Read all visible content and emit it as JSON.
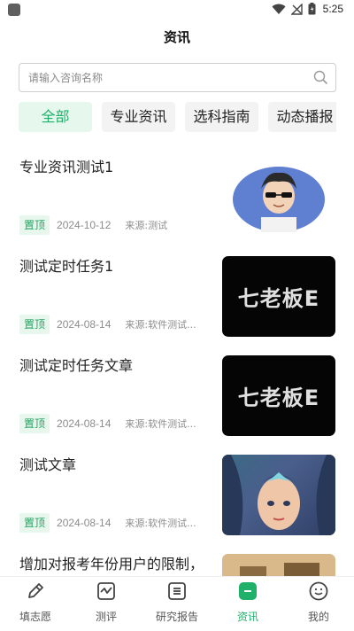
{
  "status_bar": {
    "time": "5:25"
  },
  "header": {
    "title": "资讯"
  },
  "search": {
    "placeholder": "请输入咨询名称"
  },
  "tabs": [
    {
      "label": "全部",
      "active": true
    },
    {
      "label": "专业资讯",
      "active": false
    },
    {
      "label": "选科指南",
      "active": false
    },
    {
      "label": "动态播报",
      "active": false
    }
  ],
  "articles": [
    {
      "title": "专业资讯测试1",
      "pin": "置顶",
      "date": "2024-10-12",
      "source": "来源:测试",
      "thumb": "avatar-cartoon-image"
    },
    {
      "title": "测试定时任务1",
      "pin": "置顶",
      "date": "2024-08-14",
      "source": "来源:软件测试...",
      "thumb": "七老板E"
    },
    {
      "title": "测试定时任务文章",
      "pin": "置顶",
      "date": "2024-08-14",
      "source": "来源:软件测试...",
      "thumb": "七老板E"
    },
    {
      "title": "测试文章",
      "pin": "置顶",
      "date": "2024-08-14",
      "source": "来源:软件测试...",
      "thumb": "game-hero-image"
    },
    {
      "title": "增加对报考年份用户的限制，根据省份、报考开启后非报",
      "pin": "",
      "date": "",
      "source": "",
      "thumb": "scene-image"
    }
  ],
  "tabbar": [
    {
      "label": "填志愿",
      "icon": "pencil-icon",
      "active": false
    },
    {
      "label": "测评",
      "icon": "chart-icon",
      "active": false
    },
    {
      "label": "研究报告",
      "icon": "report-icon",
      "active": false
    },
    {
      "label": "资讯",
      "icon": "news-icon",
      "active": true
    },
    {
      "label": "我的",
      "icon": "smile-icon",
      "active": false
    }
  ],
  "colors": {
    "accent": "#1fb06a",
    "pin_bg": "#e8f7ee",
    "tab_bg": "#f3f3f3"
  }
}
